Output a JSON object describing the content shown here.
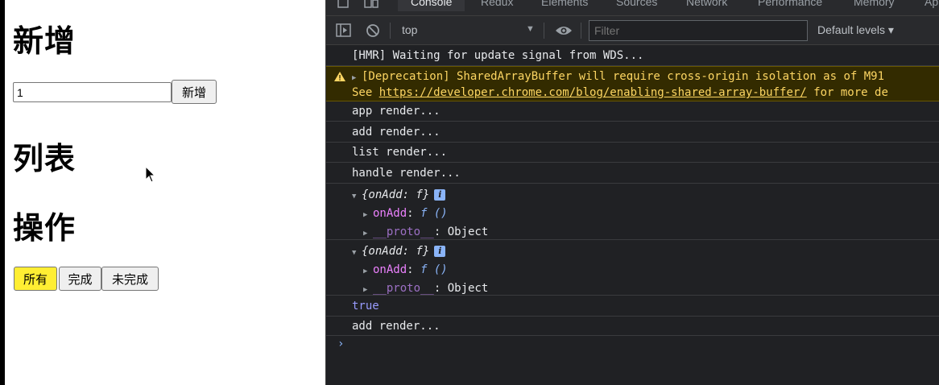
{
  "app": {
    "heading_add": "新增",
    "input_value": "1",
    "add_button": "新增",
    "heading_list": "列表",
    "heading_ops": "操作",
    "filter_buttons": [
      "所有",
      "完成",
      "未完成"
    ]
  },
  "devtools": {
    "tabs": [
      "Console",
      "Redux",
      "Elements",
      "Sources",
      "Network",
      "Performance",
      "Memory",
      "Ap"
    ],
    "context": "top",
    "filter_placeholder": "Filter",
    "levels": "Default levels ▾",
    "logs": {
      "l0": "[HMR] Waiting for update signal from WDS...",
      "warn1": "[Deprecation] SharedArrayBuffer will require cross-origin isolation as of M91",
      "warn2_prefix": "See ",
      "warn2_link": "https://developer.chrome.com/blog/enabling-shared-array-buffer/",
      "warn2_suffix": " for more de",
      "l1": "app render...",
      "l2": "add render...",
      "l3": "list render...",
      "l4": "handle render...",
      "obj1_head": "{onAdd: f}",
      "obj1_key": "onAdd",
      "obj1_val": "f ()",
      "obj1_proto": "__proto__",
      "obj1_proto_val": ": Object",
      "obj2_head": "{onAdd: f}",
      "obj2_key": "onAdd",
      "obj2_val": "f ()",
      "obj2_proto": "__proto__",
      "obj2_proto_val": ": Object",
      "bool": "true",
      "l5": "add render..."
    },
    "prompt": "›"
  }
}
